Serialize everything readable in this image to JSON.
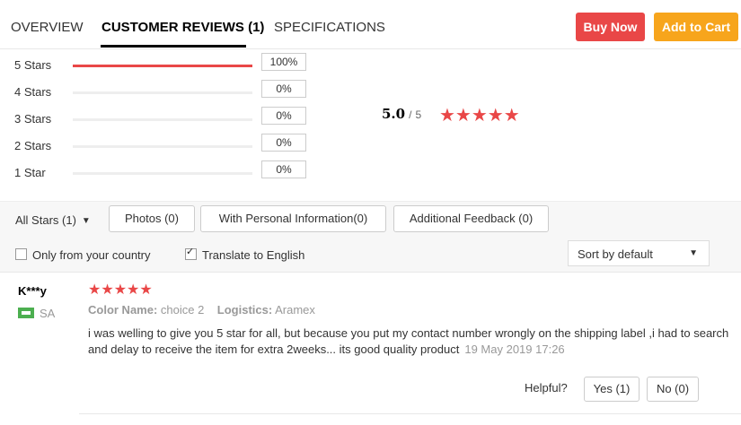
{
  "tabs": [
    {
      "label": "OVERVIEW"
    },
    {
      "label": "CUSTOMER REVIEWS (1)"
    },
    {
      "label": "SPECIFICATIONS"
    }
  ],
  "actions": {
    "buy_now": "Buy Now",
    "add_to_cart": "Add to Cart"
  },
  "colors": {
    "accent_red": "#e94747",
    "accent_orange": "#f7a51c"
  },
  "rating_breakdown": [
    {
      "label": "5 Stars",
      "percent_text": "100%",
      "fraction": 1.0
    },
    {
      "label": "4 Stars",
      "percent_text": "0%",
      "fraction": 0
    },
    {
      "label": "3 Stars",
      "percent_text": "0%",
      "fraction": 0
    },
    {
      "label": "2 Stars",
      "percent_text": "0%",
      "fraction": 0
    },
    {
      "label": "1 Star",
      "percent_text": "0%",
      "fraction": 0
    }
  ],
  "average": {
    "score": "5.0",
    "separator": "/",
    "out_of": "5",
    "stars": "★★★★★"
  },
  "filters": {
    "all_stars": "All Stars (1)",
    "buttons": [
      {
        "label": "Photos (0)"
      },
      {
        "label": "With Personal Information(0)"
      },
      {
        "label": "Additional Feedback (0)"
      }
    ],
    "only_country": "Only from your country",
    "translate": "Translate to English",
    "sort": "Sort by default"
  },
  "review": {
    "reviewer": "K***y",
    "country": "SA",
    "stars": "★★★★★",
    "color_label": "Color Name:",
    "color_value": "choice 2",
    "logistics_label": "Logistics:",
    "logistics_value": "Aramex",
    "text": "i was welling to give you 5 star for all, but because you put my contact number wrongly on the shipping label ,i had to search and delay to receive the item for extra 2weeks... its good quality product",
    "date": "19 May 2019 17:26",
    "helpful_label": "Helpful?",
    "yes": "Yes (1)",
    "no": "No (0)"
  }
}
